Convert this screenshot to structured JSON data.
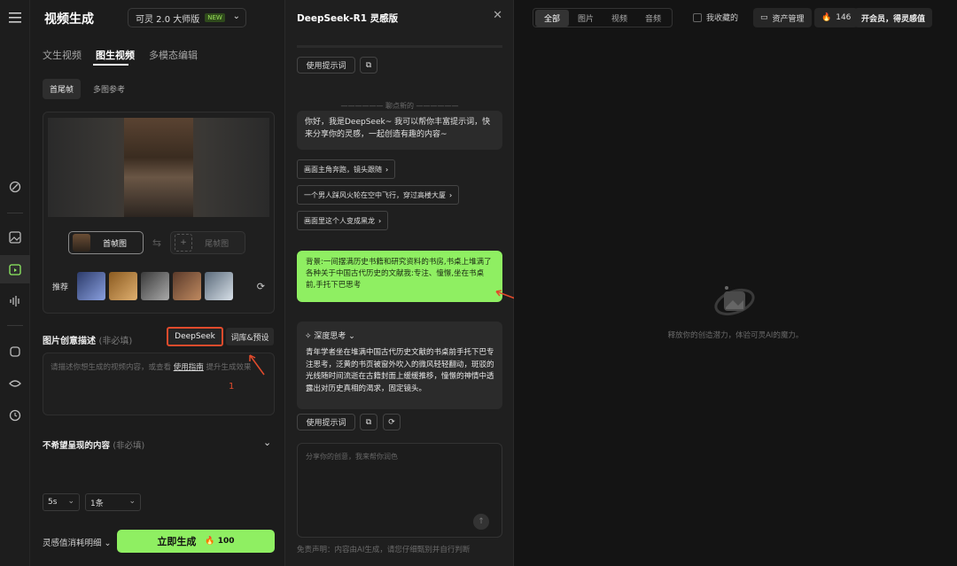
{
  "header": {
    "title": "视频生成",
    "model": "可灵 2.0 大师版",
    "model_badge": "NEW"
  },
  "tabs": [
    "文生视频",
    "图生视频",
    "多模态编辑"
  ],
  "subtabs": [
    "首尾帧",
    "多图参考"
  ],
  "frames": {
    "first": "首帧图",
    "last": "尾帧图"
  },
  "recommend_label": "推荐",
  "description": {
    "label": "图片创意描述",
    "optional": "(非必填)",
    "deepseek": "DeepSeek",
    "library": "词库&预设",
    "placeholder_a": "请描述你想生成的视频内容，或查看",
    "guide": "使用指南",
    "placeholder_b": "提升生成效果",
    "annotation": "1"
  },
  "negative": {
    "label": "不希望呈现的内容",
    "optional": "(非必填)"
  },
  "options": {
    "duration": "5s",
    "count": "1条"
  },
  "footer": {
    "cost_label": "灵感值消耗明细",
    "generate": "立即生成",
    "points": "100"
  },
  "chat": {
    "title": "DeepSeek-R1 灵感版",
    "use_prompt": "使用提示词",
    "divider": "聊点新的",
    "greeting": "你好，我是DeepSeek~ 我可以帮你丰富提示词，快来分享你的灵感，一起创造有趣的内容~",
    "suggestions": [
      "画面主角奔跑，镜头跟随",
      "一个男人踩风火轮在空中飞行，穿过高楼大厦",
      "画面里这个人变成黑龙"
    ],
    "user_msg": "背景:一间摆满历史书籍和研究资料的书房,书桌上堆满了各种关于中国古代历史的文献我:专注、憧憬,坐在书桌前,手托下巴思考",
    "think_label": "深度思考",
    "answer": "青年学者坐在堆满中国古代历史文献的书桌前手托下巴专注思考，泛黄的书页被窗外吹入的微风轻轻翻动，斑驳的光线随时间流逝在古籍封面上缓缓推移，憧憬的神情中透露出对历史真相的渴求，固定镜头。",
    "input_placeholder": "分享你的创意，我来帮你润色",
    "disclaimer": "免责声明：内容由AI生成，请您仔细甄别并自行判断",
    "annotation": "2"
  },
  "right": {
    "filters": [
      "全部",
      "图片",
      "视频",
      "音频"
    ],
    "favorites": "我收藏的",
    "asset": "资产管理",
    "points": "146",
    "vip": "开会员，得灵感值",
    "empty": "释放你的创造潜力，体验可灵AI的魔力。"
  }
}
